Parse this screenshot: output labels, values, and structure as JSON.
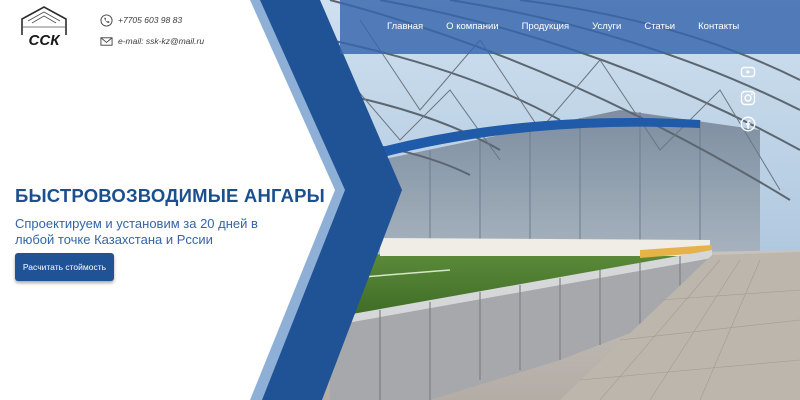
{
  "logo": {
    "text": "ССК",
    "name": "ssk-logo"
  },
  "contacts": {
    "phone": "+7705 603 98 83",
    "email": "e-mail: ssk-kz@mail.ru"
  },
  "nav": {
    "items": [
      {
        "label": "Главная"
      },
      {
        "label": "О компании"
      },
      {
        "label": "Продукция"
      },
      {
        "label": "Услуги"
      },
      {
        "label": "Статьи"
      },
      {
        "label": "Контакты"
      }
    ]
  },
  "social": {
    "icons": [
      "youtube-icon",
      "instagram-icon",
      "facebook-icon"
    ]
  },
  "hero": {
    "title": "БЫСТРОВОЗВОДИМЫЕ АНГАРЫ",
    "subtitle": "Спроектируем и установим за 20 дней в любой точке Казахстана и Рссии",
    "cta_label": "Расчитать стоймость"
  },
  "colors": {
    "brand_blue": "#1f5396",
    "title_blue": "#1c4f8e",
    "nav_bg": "#3665ac",
    "light_blue_band": "#8fb0d6"
  }
}
